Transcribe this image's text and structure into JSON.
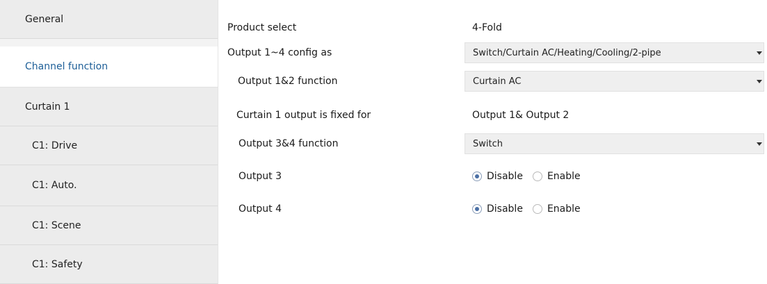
{
  "sidebar": {
    "items": [
      {
        "label": "General"
      },
      {
        "label": "Channel function",
        "active": true
      },
      {
        "label": "Curtain 1"
      },
      {
        "label": "C1: Drive"
      },
      {
        "label": "C1: Auto."
      },
      {
        "label": "C1: Scene"
      },
      {
        "label": "C1: Safety"
      }
    ]
  },
  "params": {
    "product_select": {
      "label": "Product select",
      "value": "4-Fold"
    },
    "output_1_4_config": {
      "label": "Output 1~4 config as",
      "value": "Switch/Curtain AC/Heating/Cooling/2-pipe"
    },
    "output_1_2_function": {
      "label": "Output 1&2 function",
      "value": "Curtain AC"
    },
    "curtain_1_fixed": {
      "label": "Curtain 1 output is fixed for",
      "value": "Output 1& Output 2"
    },
    "output_3_4_function": {
      "label": "Output 3&4 function",
      "value": "Switch"
    },
    "output_3": {
      "label": "Output 3",
      "options": [
        "Disable",
        "Enable"
      ],
      "selected": "Disable"
    },
    "output_4": {
      "label": "Output 4",
      "options": [
        "Disable",
        "Enable"
      ],
      "selected": "Disable"
    }
  },
  "colors": {
    "active_nav_text": "#1e5f98",
    "radio_selected": "#4a6fa5"
  }
}
